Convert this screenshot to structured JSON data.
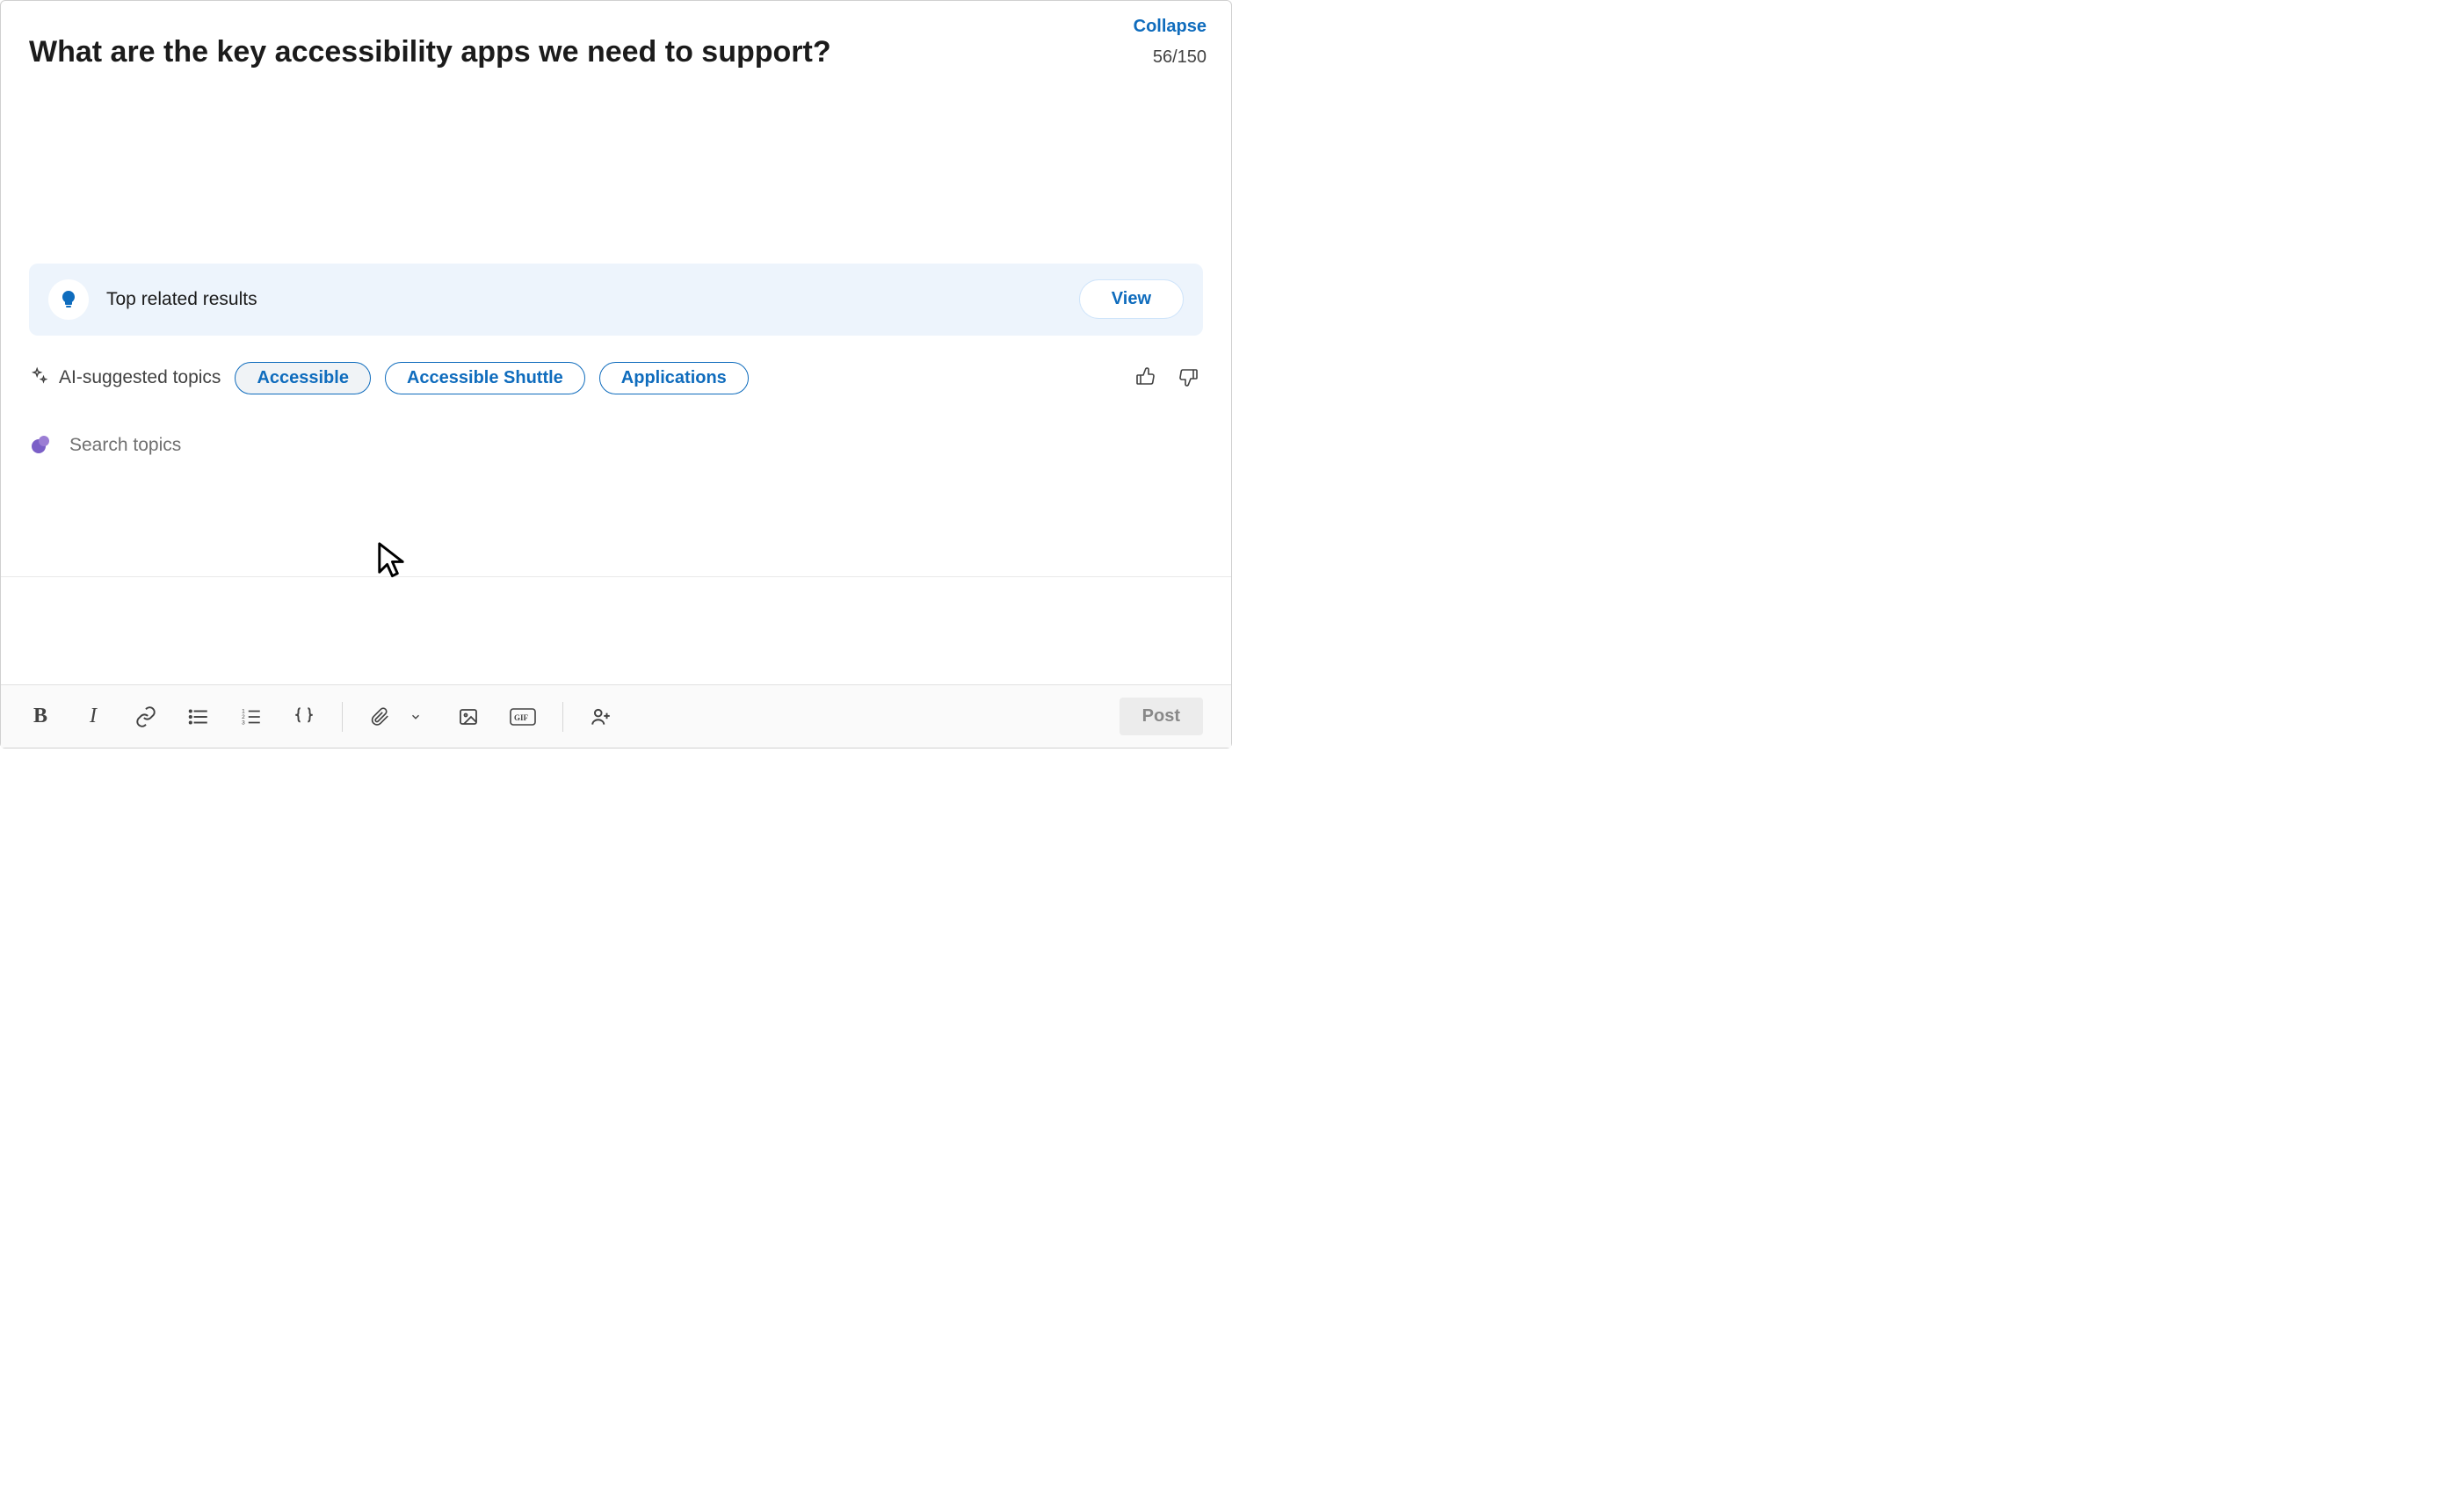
{
  "header": {
    "collapse": "Collapse",
    "counter": "56/150",
    "title": "What are the key accessibility apps we need to support?"
  },
  "related": {
    "label": "Top related results",
    "view": "View"
  },
  "ai": {
    "label": "AI-suggested topics",
    "pills": [
      "Accessible",
      "Accessible Shuttle",
      "Applications"
    ]
  },
  "search": {
    "placeholder": "Search topics"
  },
  "toolbar": {
    "post": "Post"
  }
}
